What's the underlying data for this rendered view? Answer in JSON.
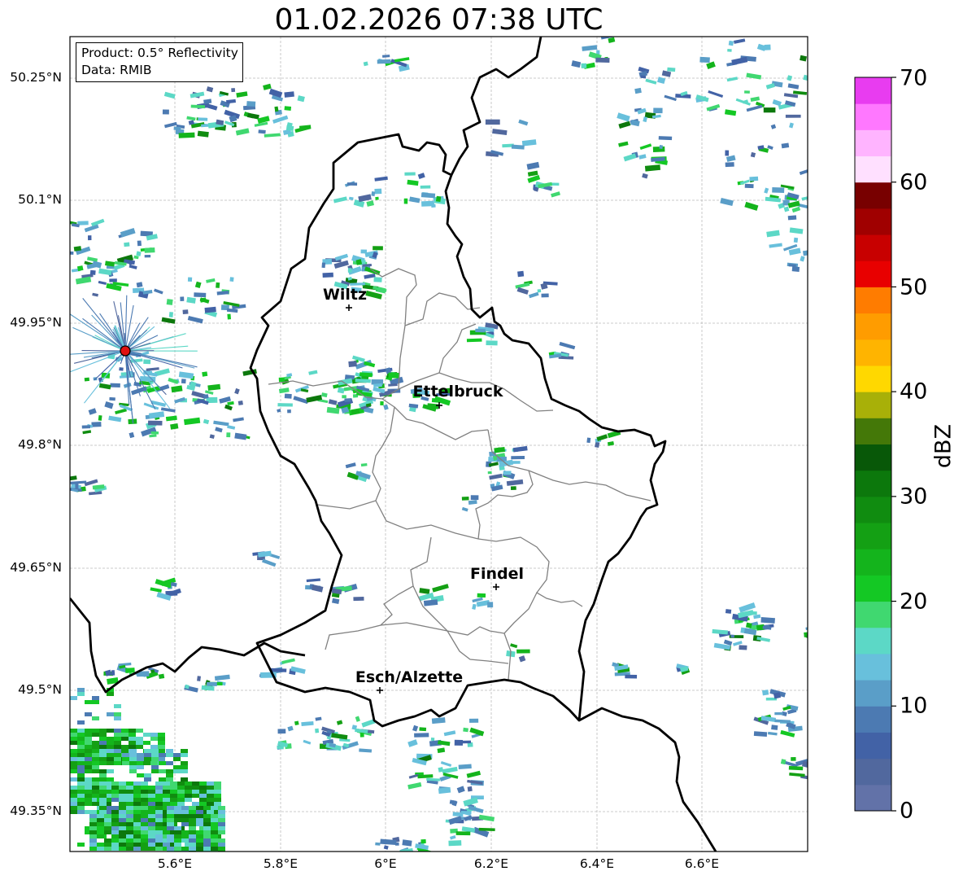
{
  "title": "01.02.2026 07:38 UTC",
  "info": {
    "product_line": "Product: 0.5° Reflectivity",
    "data_line": "Data: RMIB"
  },
  "axes": {
    "lat_labels": [
      "50.25°N",
      "50.1°N",
      "49.95°N",
      "49.8°N",
      "49.65°N",
      "49.5°N",
      "49.35°N"
    ],
    "lon_labels": [
      "5.6°E",
      "5.8°E",
      "6°E",
      "6.2°E",
      "6.4°E",
      "6.6°E"
    ]
  },
  "cities": [
    {
      "name": "Wiltz"
    },
    {
      "name": "Ettelbruck"
    },
    {
      "name": "Findel"
    },
    {
      "name": "Esch/Alzette"
    }
  ],
  "colorbar": {
    "label": "dBZ",
    "ticks": [
      "0",
      "10",
      "20",
      "30",
      "40",
      "50",
      "60",
      "70"
    ],
    "colors": [
      "#6272a8",
      "#51689e",
      "#4262a6",
      "#4c7ab2",
      "#5a9ec8",
      "#68c0dc",
      "#5cd8c6",
      "#40d870",
      "#14c824",
      "#14b41c",
      "#14a014",
      "#108c10",
      "#0c780c",
      "#085808",
      "#447808",
      "#a8b008",
      "#ffd800",
      "#ffb400",
      "#ff9c00",
      "#ff7c00",
      "#e80000",
      "#c80000",
      "#a00000",
      "#780000",
      "#ffe0ff",
      "#ffb4ff",
      "#ff78ff",
      "#e83cf0"
    ]
  },
  "colors": {
    "border": "#000000",
    "canton_lines": "#808080",
    "radar_site": "#e01010",
    "grid": "#bbbbbb"
  }
}
